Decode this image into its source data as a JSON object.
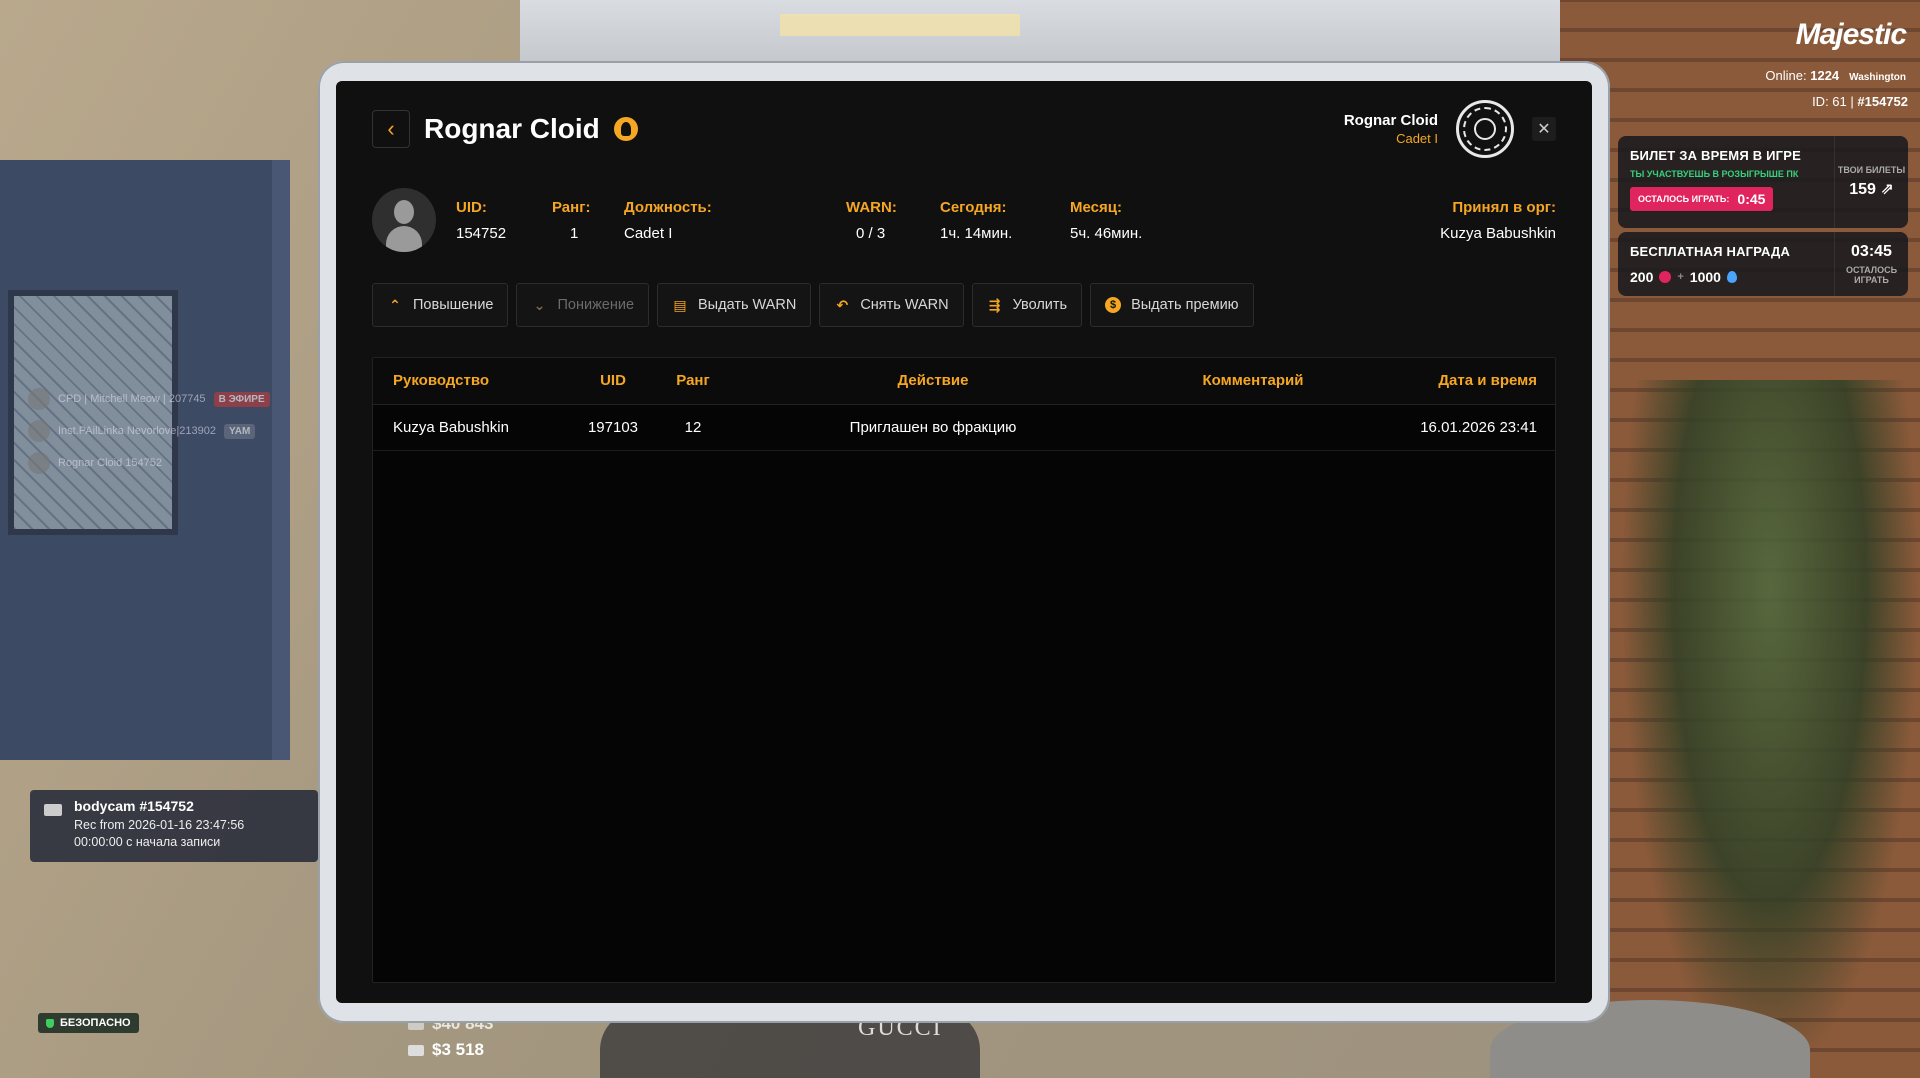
{
  "hud": {
    "logo": "Majestic",
    "online_label": "Online:",
    "online_count": "1224",
    "server": "Washington",
    "id_label": "ID: 61 |",
    "id_value": "#154752",
    "ticket": {
      "title": "БИЛЕТ ЗА ВРЕМЯ В ИГРЕ",
      "subtitle": "ТЫ УЧАСТВУЕШЬ В РОЗЫГРЫШЕ ПК",
      "remaining_label": "ОСТАЛОСЬ ИГРАТЬ:",
      "remaining_time": "0:45",
      "side_label": "ТВОИ БИЛЕТЫ",
      "count": "159"
    },
    "reward": {
      "title": "БЕСПЛАТНАЯ НАГРАДА",
      "amount_a": "200",
      "plus": "+",
      "amount_b": "1000",
      "time": "03:45",
      "side_label": "ОСТАЛОСЬ ИГРАТЬ"
    },
    "voice": [
      {
        "name": "CPD | Mitchell Meow | 207745",
        "badge": "В ЭФИРЕ"
      },
      {
        "name": "Inst.PAilLinka Nevorlove|213902",
        "badge": "YAM"
      },
      {
        "name": "Rognar Cloid 154752",
        "badge": ""
      }
    ],
    "bodycam": {
      "title": "bodycam #154752",
      "rec": "Rec from 2026-01-16 23:47:56",
      "elapsed": "00:00:00 с начала записи"
    },
    "safe": "БЕЗОПАСНО",
    "money_top": "$40 843",
    "money_bottom": "$3 518",
    "gucci": "GUCCI"
  },
  "modal": {
    "back_icon": "chevron-left-icon",
    "title": "Rognar Cloid",
    "viewer_name": "Rognar Cloid",
    "viewer_rank": "Cadet I",
    "close_icon": "close-icon",
    "info": {
      "uid_label": "UID:",
      "uid": "154752",
      "rank_label": "Ранг:",
      "rank": "1",
      "post_label": "Должность:",
      "post": "Cadet I",
      "warn_label": "WARN:",
      "warn": "0 / 3",
      "today_label": "Сегодня:",
      "today": "1ч. 14мин.",
      "month_label": "Месяц:",
      "month": "5ч. 46мин.",
      "accepted_label": "Принял в орг:",
      "accepted": "Kuzya Babushkin"
    },
    "actions": [
      {
        "label": "Повышение",
        "icon": "arrow-up-icon",
        "disabled": false
      },
      {
        "label": "Понижение",
        "icon": "arrow-down-icon",
        "disabled": true
      },
      {
        "label": "Выдать WARN",
        "icon": "warn-doc-icon",
        "disabled": false
      },
      {
        "label": "Снять WARN",
        "icon": "undo-icon",
        "disabled": false
      },
      {
        "label": "Уволить",
        "icon": "fire-icon",
        "disabled": false
      },
      {
        "label": "Выдать премию",
        "icon": "coin-icon",
        "disabled": false
      }
    ],
    "table": {
      "headers": [
        "Руководство",
        "UID",
        "Ранг",
        "Действие",
        "Комментарий",
        "Дата и время"
      ],
      "rows": [
        [
          "Kuzya Babushkin",
          "197103",
          "12",
          "Приглашен во фракцию",
          "",
          "16.01.2026 23:41"
        ]
      ]
    }
  },
  "colors": {
    "accent": "#f5a623",
    "panel": "#101010",
    "danger": "#e0245e"
  }
}
